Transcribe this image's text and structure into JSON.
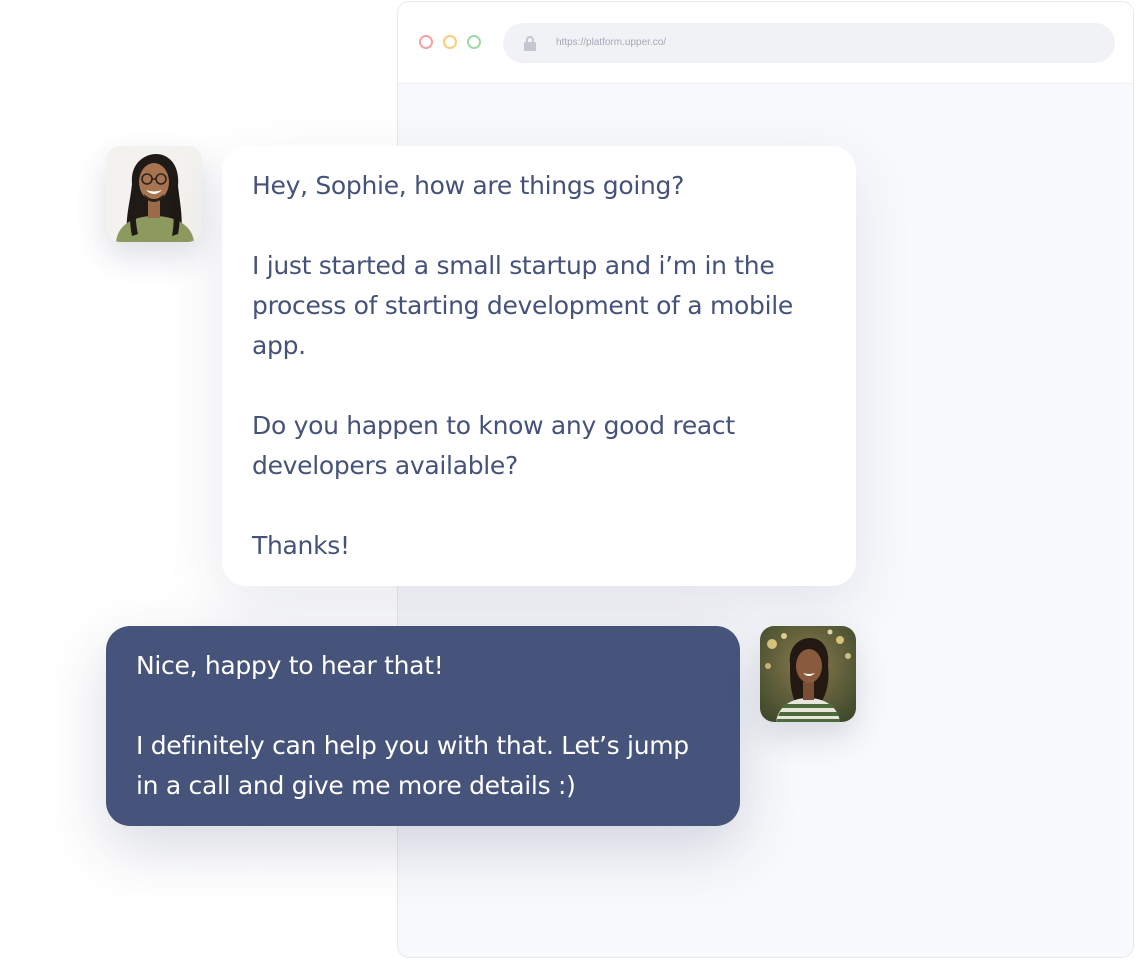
{
  "browser": {
    "url": "https://platform.upper.co/",
    "controls": [
      "close-dot",
      "minimize-dot",
      "maximize-dot"
    ],
    "colors": {
      "close": "#f0a3a3",
      "minimize": "#f4cf7e",
      "maximize": "#9fd8a4"
    }
  },
  "chat": {
    "incoming": {
      "paragraphs": [
        "Hey, Sophie, how are things going?",
        "I just started a small startup and i’m in the process of starting development of a mobile app.",
        "Do you happen to know any good react developers available?",
        "Thanks!"
      ],
      "bubble_color": "#ffffff",
      "text_color": "#45527a"
    },
    "outgoing": {
      "paragraphs": [
        "Nice, happy to hear that!",
        "I definitely can help you with that. Let’s jump in a call and give me more details :)"
      ],
      "bubble_color": "#46537a",
      "text_color": "#ffffff"
    }
  }
}
